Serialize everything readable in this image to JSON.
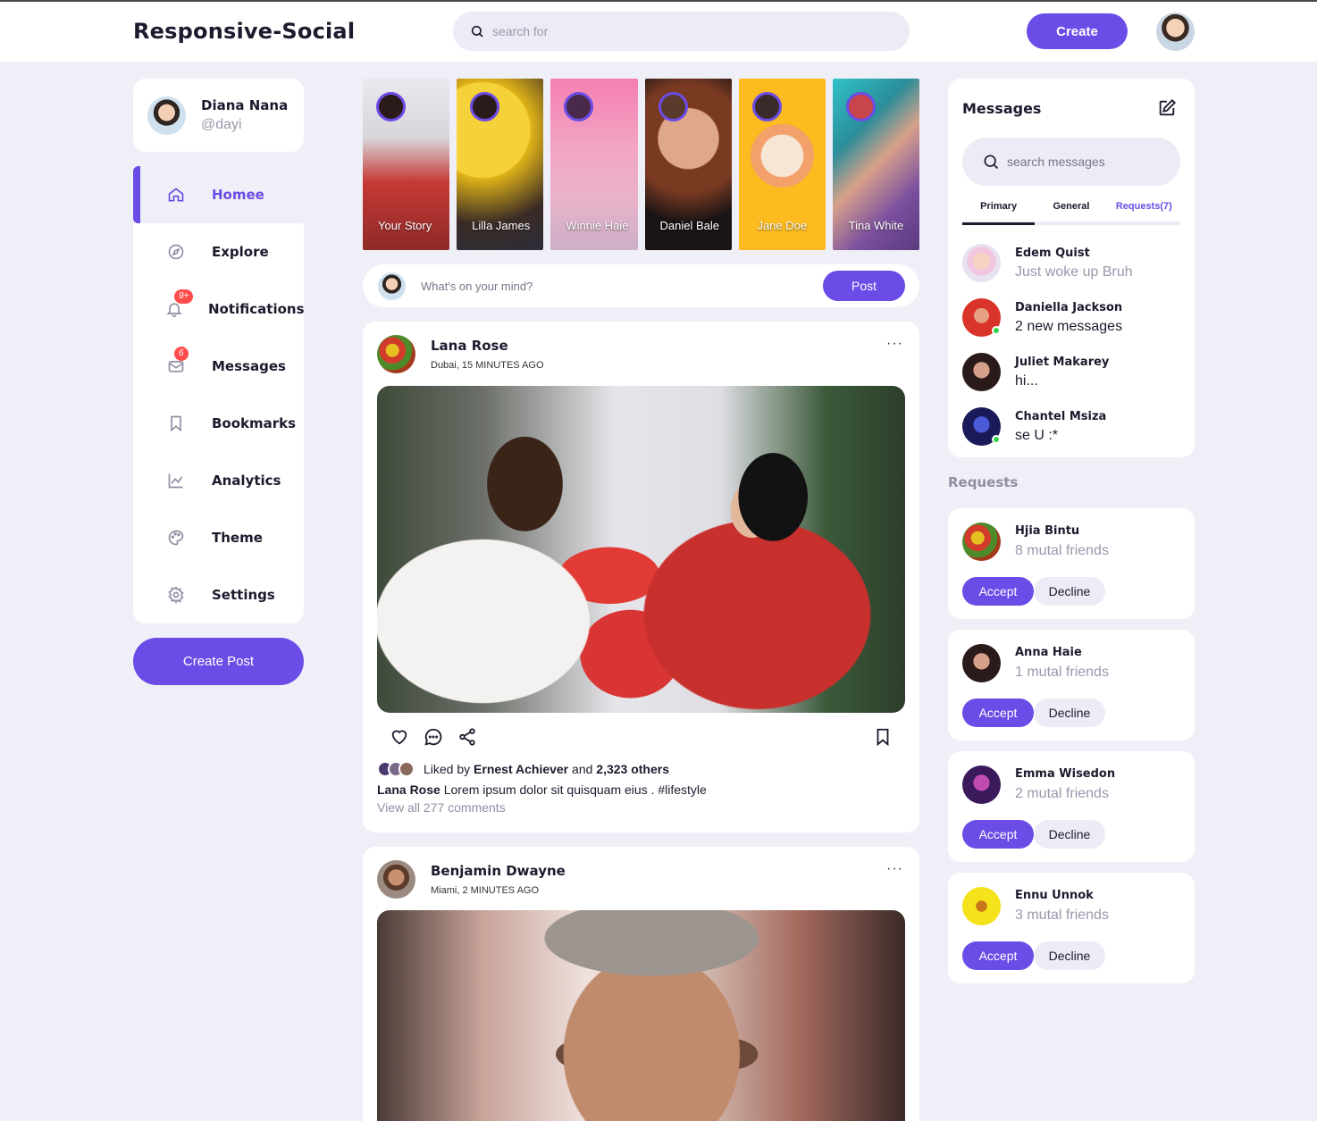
{
  "brand": {
    "logo": "Responsive-Social",
    "accent": "#6b4ce6"
  },
  "search": {
    "placeholder": "search for"
  },
  "header": {
    "create_label": "Create"
  },
  "profile": {
    "name": "Diana Nana",
    "handle": "@dayi"
  },
  "sidebar": {
    "items": [
      {
        "label": "Homee",
        "icon": "home-icon",
        "active": true
      },
      {
        "label": "Explore",
        "icon": "compass-icon"
      },
      {
        "label": "Notifications",
        "icon": "bell-icon",
        "badge": "9+"
      },
      {
        "label": "Messages",
        "icon": "envelope-icon",
        "badge": "6"
      },
      {
        "label": "Bookmarks",
        "icon": "bookmark-icon"
      },
      {
        "label": "Analytics",
        "icon": "chart-icon"
      },
      {
        "label": "Theme",
        "icon": "palette-icon"
      },
      {
        "label": "Settings",
        "icon": "gear-icon"
      }
    ],
    "create_post_label": "Create Post"
  },
  "stories": [
    {
      "name": "Your Story"
    },
    {
      "name": "Lilla James"
    },
    {
      "name": "Winnie Haie"
    },
    {
      "name": "Daniel Bale"
    },
    {
      "name": "Jane Doe"
    },
    {
      "name": "Tina White"
    }
  ],
  "composer": {
    "placeholder": "What's on your mind?",
    "post_label": "Post"
  },
  "feeds": [
    {
      "author": "Lana Rose",
      "location": "Dubai, 15 MINUTES AGO",
      "liked_prefix": "Liked by",
      "liked_by": "Ernest Achiever",
      "liked_and": "and",
      "liked_others": "2,323 others",
      "caption_author": "Lana Rose",
      "caption": "Lorem ipsum dolor sit quisquam eius . #lifestyle",
      "comments": "View all 277 comments"
    },
    {
      "author": "Benjamin Dwayne",
      "location": "Miami, 2 MINUTES AGO"
    }
  ],
  "messages": {
    "title": "Messages",
    "search_placeholder": "search messages",
    "tabs": [
      "Primary",
      "General",
      "Requests(7)"
    ],
    "items": [
      {
        "name": "Edem Quist",
        "text": "Just woke up Bruh",
        "unread": false,
        "online": false
      },
      {
        "name": "Daniella Jackson",
        "text": "2 new messages",
        "unread": true,
        "online": true
      },
      {
        "name": "Juliet Makarey",
        "text": "hi...",
        "unread": true,
        "online": false
      },
      {
        "name": "Chantel Msiza",
        "text": "se U :*",
        "unread": true,
        "online": true
      }
    ]
  },
  "requests": {
    "title": "Requests",
    "accept_label": "Accept",
    "decline_label": "Decline",
    "items": [
      {
        "name": "Hjia Bintu",
        "mutual": "8 mutal friends"
      },
      {
        "name": "Anna Haie",
        "mutual": "1 mutal friends"
      },
      {
        "name": "Emma Wisedon",
        "mutual": "2 mutal friends"
      },
      {
        "name": "Ennu Unnok",
        "mutual": "3 mutal friends"
      }
    ]
  }
}
